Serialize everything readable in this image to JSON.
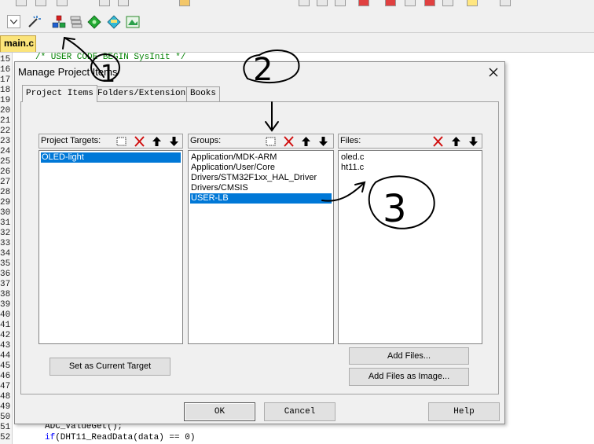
{
  "editor": {
    "tab_label": "main.c",
    "line_numbers": [
      "15",
      "16",
      "17",
      "18",
      "19",
      "20",
      "21",
      "22",
      "23",
      "24",
      "25",
      "26",
      "27",
      "28",
      "29",
      "30",
      "31",
      "32",
      "33",
      "34",
      "35",
      "36",
      "37",
      "38",
      "39",
      "40",
      "41",
      "42",
      "43",
      "44",
      "45",
      "46",
      "47",
      "48",
      "49",
      "50",
      "51",
      "52"
    ],
    "code_line_15": "/* USER CODE BEGIN SysInit */",
    "code_line_51": "ADC_ValueGet();",
    "code_line_52_kw": "if",
    "code_line_52_rest": "(DHT11_ReadData(data) == 0)"
  },
  "dialog": {
    "title": "Manage Project Items",
    "tabs": [
      "Project Items",
      "Folders/Extensions",
      "Books"
    ],
    "targets": {
      "label": "Project Targets:",
      "items": [
        "OLED-light"
      ],
      "selected": 0
    },
    "groups": {
      "label": "Groups:",
      "items": [
        "Application/MDK-ARM",
        "Application/User/Core",
        "Drivers/STM32F1xx_HAL_Driver",
        "Drivers/CMSIS",
        "USER-LB"
      ],
      "selected": 4
    },
    "files": {
      "label": "Files:",
      "items": [
        "oled.c",
        "ht11.c"
      ]
    },
    "buttons": {
      "set_current_target": "Set as Current Target",
      "add_files": "Add Files...",
      "add_files_image": "Add Files as Image...",
      "ok": "OK",
      "cancel": "Cancel",
      "help": "Help"
    }
  },
  "colors": {
    "selection": "#0078d7",
    "tab_active": "#fbe47a",
    "comment": "#008000",
    "keyword": "#0000ff"
  },
  "annotations": [
    "1",
    "2",
    "3"
  ]
}
